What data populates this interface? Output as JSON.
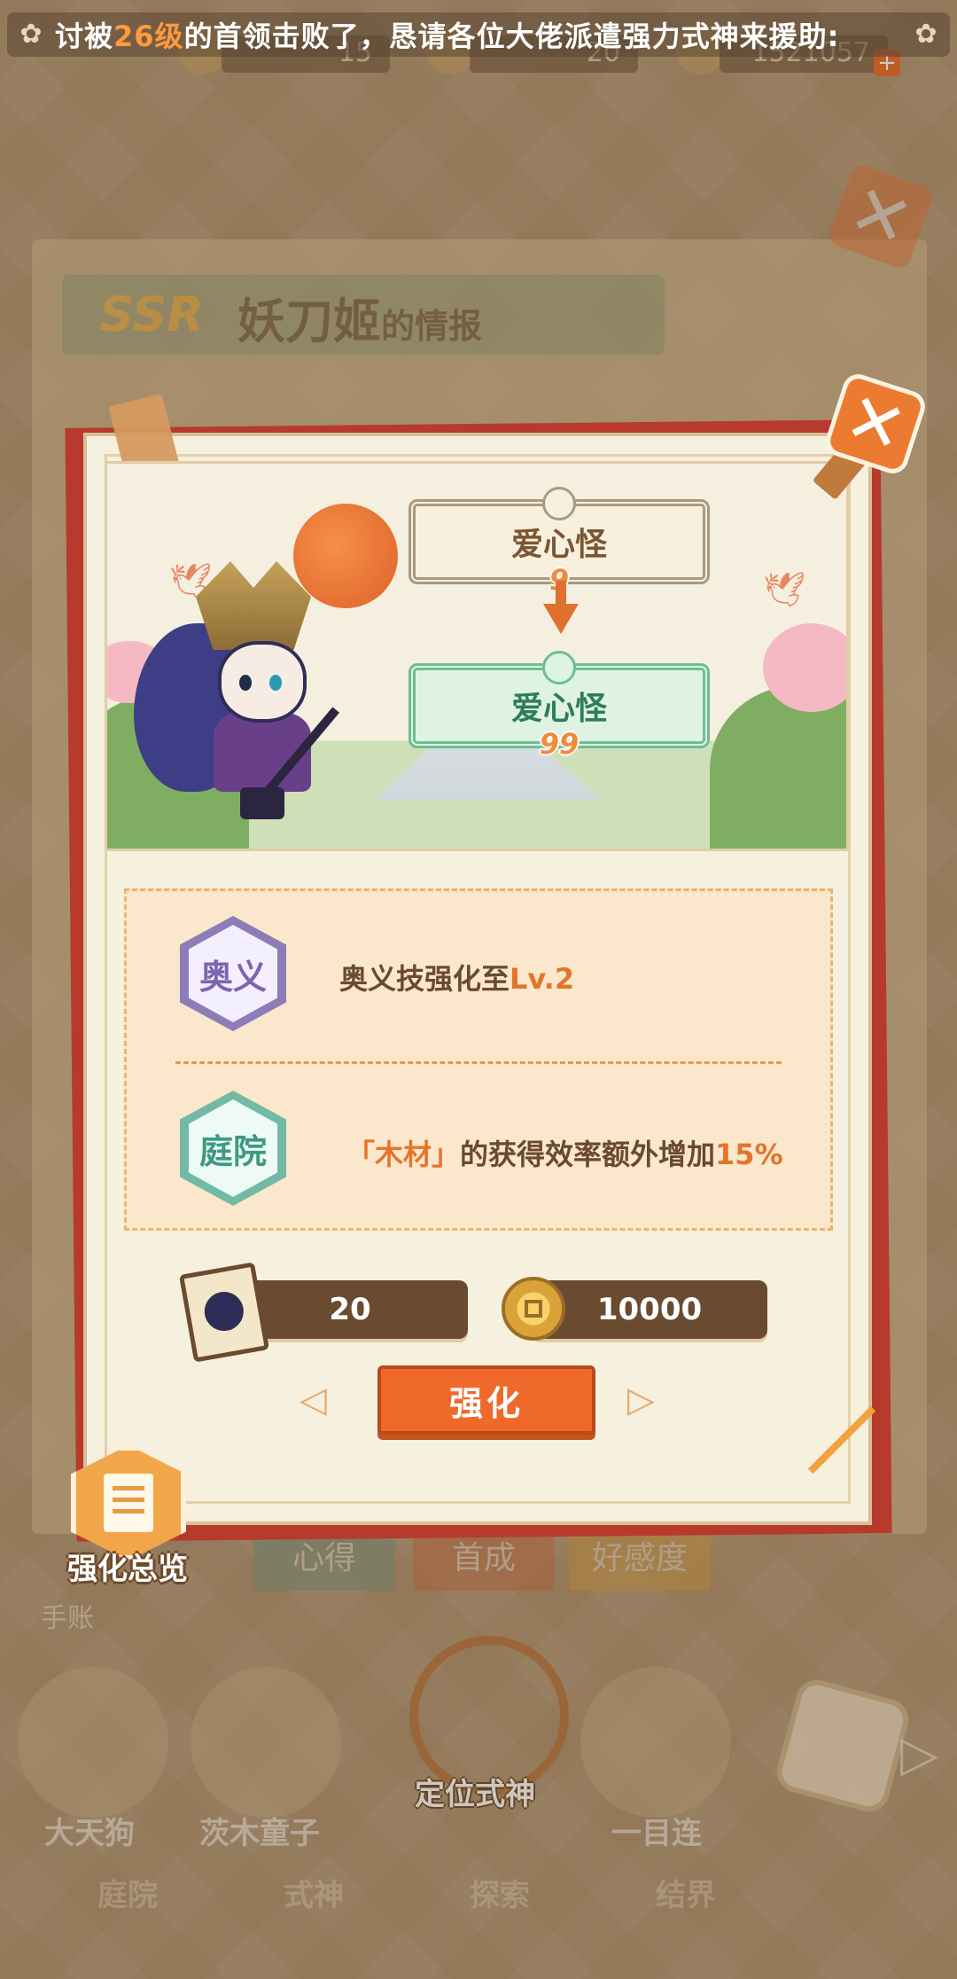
{
  "marquee": {
    "pre": "讨被",
    "level": "26级",
    "post": "的首领击败了，恳请各位大佬派遣强力式神来援助:"
  },
  "resources": [
    {
      "value": "15"
    },
    {
      "value": "20"
    },
    {
      "value": "1521057"
    }
  ],
  "background": {
    "rarity": "SSR",
    "title": "妖刀姬",
    "title_suffix": "的情报",
    "tabs": [
      "心得",
      "首成",
      "好感度"
    ],
    "handle_label": "手账",
    "characters": [
      "大天狗",
      "茨木童子",
      "一目连",
      ""
    ],
    "locate_label": "定位式神",
    "bottom_labels": [
      "庭院",
      "式神",
      "探索",
      "结界"
    ]
  },
  "popup": {
    "from_tag": {
      "name": "爱心怪",
      "level": "9"
    },
    "to_tag": {
      "name": "爱心怪",
      "level": "99"
    },
    "bonus_1": {
      "badge": "奥义",
      "text": "奥义技强化至",
      "highlight": "Lv.2"
    },
    "bonus_2": {
      "badge": "庭院",
      "quote": "「木材」",
      "text": "的获得效率额外增加",
      "highlight": "15%"
    },
    "costs": [
      {
        "icon": "character-card-icon",
        "value": "20"
      },
      {
        "icon": "gold-coin-icon",
        "value": "10000"
      }
    ],
    "upgrade_label": "强化",
    "close_icon": "close-icon"
  },
  "overview": {
    "label": "强化总览",
    "icon": "document-icon"
  },
  "colors": {
    "accent_orange": "#ef6a2a",
    "popup_border_red": "#b73a2c",
    "tag_green": "#6cbf92",
    "highlight_orange": "#e4742c"
  }
}
